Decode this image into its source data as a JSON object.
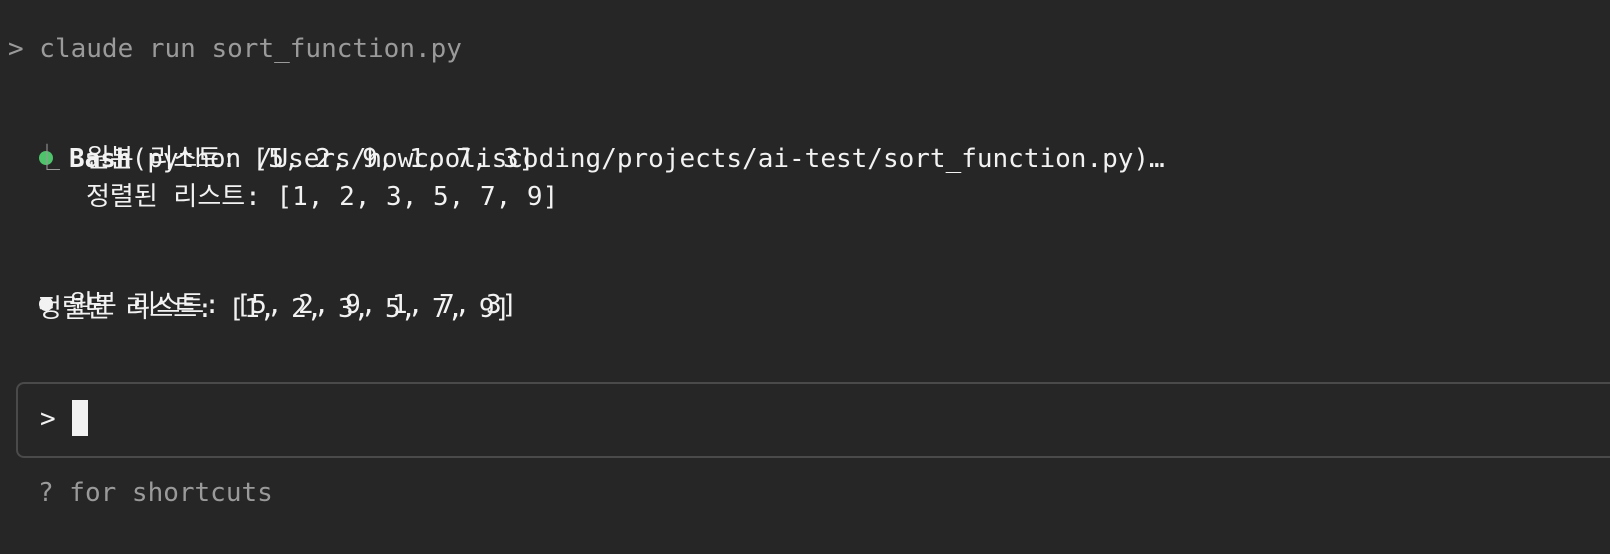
{
  "terminal": {
    "command_line": "> claude run sort_function.py",
    "tool_call": {
      "status_color": "#4ec36b",
      "tool_name": "Bash",
      "tool_args": "(python /Users/howcooliscoding/projects/ai-test/sort_function.py)…",
      "output_prefix": "⎿",
      "output_lines": [
        "원본 리스트: [5, 2, 9, 1, 7, 3]",
        "정렬된 리스트: [1, 2, 3, 5, 7, 9]"
      ]
    },
    "response": {
      "lines": [
        "원본 리스트: [5, 2, 9, 1, 7, 3]",
        "정렬된 리스트: [1, 2, 3, 5, 7, 9]"
      ]
    },
    "input": {
      "prompt": ">",
      "value": ""
    },
    "hint": "? for shortcuts"
  }
}
